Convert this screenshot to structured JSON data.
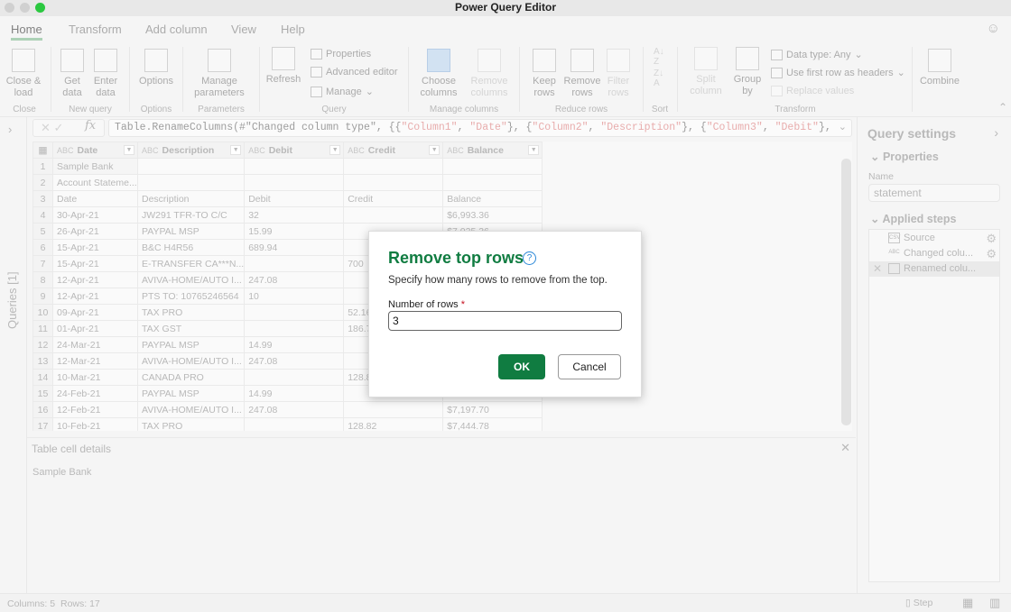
{
  "window": {
    "title": "Power Query Editor"
  },
  "tabs": [
    "Home",
    "Transform",
    "Add column",
    "View",
    "Help"
  ],
  "ribbon": {
    "close_load": "Close & load",
    "get_data": "Get data",
    "enter_data": "Enter data",
    "options": "Options",
    "manage_parameters": "Manage parameters",
    "refresh": "Refresh",
    "properties": "Properties",
    "advanced_editor": "Advanced editor",
    "manage": "Manage",
    "choose_columns": "Choose columns",
    "remove_columns": "Remove columns",
    "keep_rows": "Keep rows",
    "remove_rows": "Remove rows",
    "filter_rows": "Filter rows",
    "split_column": "Split column",
    "group_by": "Group by",
    "data_type": "Data type: Any",
    "use_first_row": "Use first row as headers",
    "replace_values": "Replace values",
    "combine": "Combine",
    "groups": {
      "close": "Close",
      "new_query": "New query",
      "options": "Options",
      "parameters": "Parameters",
      "query": "Query",
      "manage_columns": "Manage columns",
      "reduce_rows": "Reduce rows",
      "sort": "Sort",
      "transform": "Transform"
    }
  },
  "queries_label": "Queries [1]",
  "formula": {
    "parts": [
      {
        "t": "Table.RenameColumns(#\"Changed column type\", {{",
        "s": false
      },
      {
        "t": "\"Column1\"",
        "s": true
      },
      {
        "t": ", ",
        "s": false
      },
      {
        "t": "\"Date\"",
        "s": true
      },
      {
        "t": "}, {",
        "s": false
      },
      {
        "t": "\"Column2\"",
        "s": true
      },
      {
        "t": ", ",
        "s": false
      },
      {
        "t": "\"Description\"",
        "s": true
      },
      {
        "t": "}, {",
        "s": false
      },
      {
        "t": "\"Column3\"",
        "s": true
      },
      {
        "t": ", ",
        "s": false
      },
      {
        "t": "\"Debit\"",
        "s": true
      },
      {
        "t": "},",
        "s": false
      }
    ]
  },
  "grid": {
    "columns": [
      "Date",
      "Description",
      "Debit",
      "Credit",
      "Balance"
    ],
    "rows": [
      [
        "Sample Bank",
        "",
        "",
        "",
        ""
      ],
      [
        "Account Stateme...",
        "",
        "",
        "",
        ""
      ],
      [
        "Date",
        "Description",
        "Debit",
        "Credit",
        "Balance"
      ],
      [
        "30-Apr-21",
        "JW291 TFR-TO C/C",
        "32",
        "",
        "$6,993.36"
      ],
      [
        "26-Apr-21",
        "PAYPAL MSP",
        "15.99",
        "",
        "$7,025.36"
      ],
      [
        "15-Apr-21",
        "B&C H4R56",
        "689.94",
        "",
        ""
      ],
      [
        "15-Apr-21",
        "E-TRANSFER CA***N...",
        "",
        "700",
        ""
      ],
      [
        "12-Apr-21",
        "AVIVA-HOME/AUTO I...",
        "247.08",
        "",
        ""
      ],
      [
        "12-Apr-21",
        "PTS TO: 10765246564",
        "10",
        "",
        ""
      ],
      [
        "09-Apr-21",
        "TAX PRO",
        "",
        "52.16",
        ""
      ],
      [
        "01-Apr-21",
        "TAX GST",
        "",
        "186.75",
        ""
      ],
      [
        "24-Mar-21",
        "PAYPAL MSP",
        "14.99",
        "",
        ""
      ],
      [
        "12-Mar-21",
        "AVIVA-HOME/AUTO I...",
        "247.08",
        "",
        ""
      ],
      [
        "10-Mar-21",
        "CANADA PRO",
        "",
        "128.82",
        ""
      ],
      [
        "24-Feb-21",
        "PAYPAL MSP",
        "14.99",
        "",
        ""
      ],
      [
        "12-Feb-21",
        "AVIVA-HOME/AUTO I...",
        "247.08",
        "",
        "$7,197.70"
      ],
      [
        "10-Feb-21",
        "TAX PRO",
        "",
        "128.82",
        "$7,444.78"
      ]
    ]
  },
  "details": {
    "title": "Table cell details",
    "value": "Sample Bank"
  },
  "query_settings": {
    "title": "Query settings",
    "properties": "Properties",
    "name_label": "Name",
    "name_value": "statement",
    "applied_steps": "Applied steps",
    "steps": [
      {
        "label": "Source",
        "icon": "csv-icon"
      },
      {
        "label": "Changed colu...",
        "icon": "abc-123-icon"
      },
      {
        "label": "Renamed colu...",
        "icon": "rename-icon"
      }
    ]
  },
  "status": {
    "columns": "Columns: 5",
    "rows": "Rows: 17",
    "step": "Step"
  },
  "dialog": {
    "title": "Remove top rows",
    "description": "Specify how many rows to remove from the top.",
    "field_label": "Number of rows",
    "required": "*",
    "field_value": "3",
    "ok": "OK",
    "cancel": "Cancel"
  },
  "colors": {
    "accent": "#107c41",
    "help": "#2b88d8"
  }
}
